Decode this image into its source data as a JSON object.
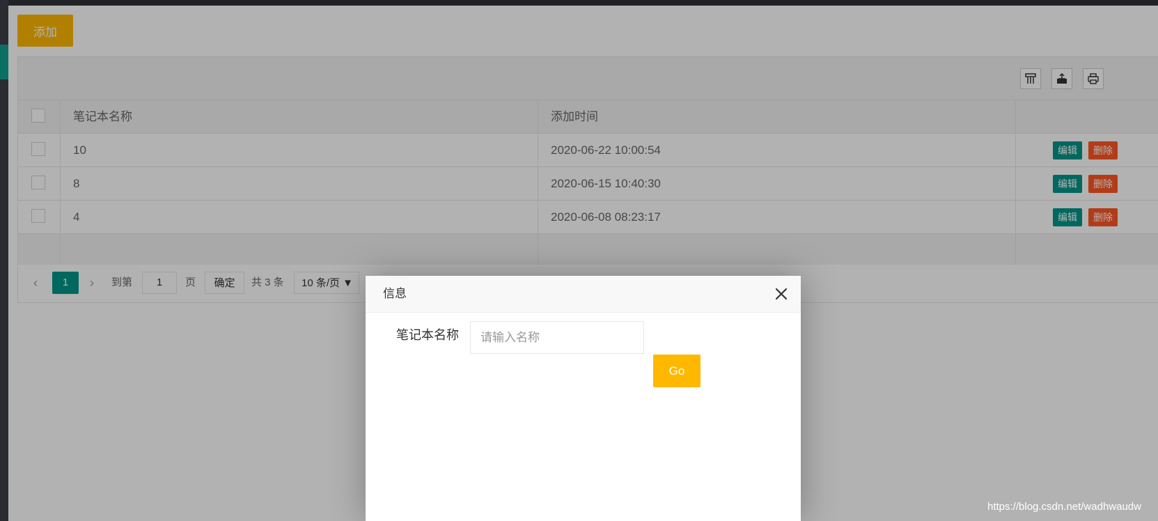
{
  "toolbar": {
    "add_label": "添加",
    "icons": [
      "columns-icon",
      "export-icon",
      "print-icon"
    ]
  },
  "table": {
    "headers": {
      "name": "笔记本名称",
      "time": "添加时间"
    },
    "rows": [
      {
        "name": "10",
        "time": "2020-06-22 10:00:54"
      },
      {
        "name": "8",
        "time": "2020-06-15 10:40:30"
      },
      {
        "name": "4",
        "time": "2020-06-08 08:23:17"
      }
    ],
    "actions": {
      "edit": "编辑",
      "delete": "删除"
    }
  },
  "pager": {
    "prev": "‹",
    "current_page": "1",
    "next": "›",
    "goto_label": "到第",
    "goto_value": "1",
    "page_unit": "页",
    "confirm": "确定",
    "total": "共 3 条",
    "page_size": "10 条/页 ▼"
  },
  "dialog": {
    "title": "信息",
    "field_label": "笔记本名称",
    "field_placeholder": "请输入名称",
    "go_label": "Go"
  },
  "watermark": "https://blog.csdn.net/wadhwaudw",
  "colors": {
    "primary": "#009688",
    "warm": "#ffb800",
    "danger": "#ff5722",
    "sidebar_accent": "#12a08f"
  }
}
